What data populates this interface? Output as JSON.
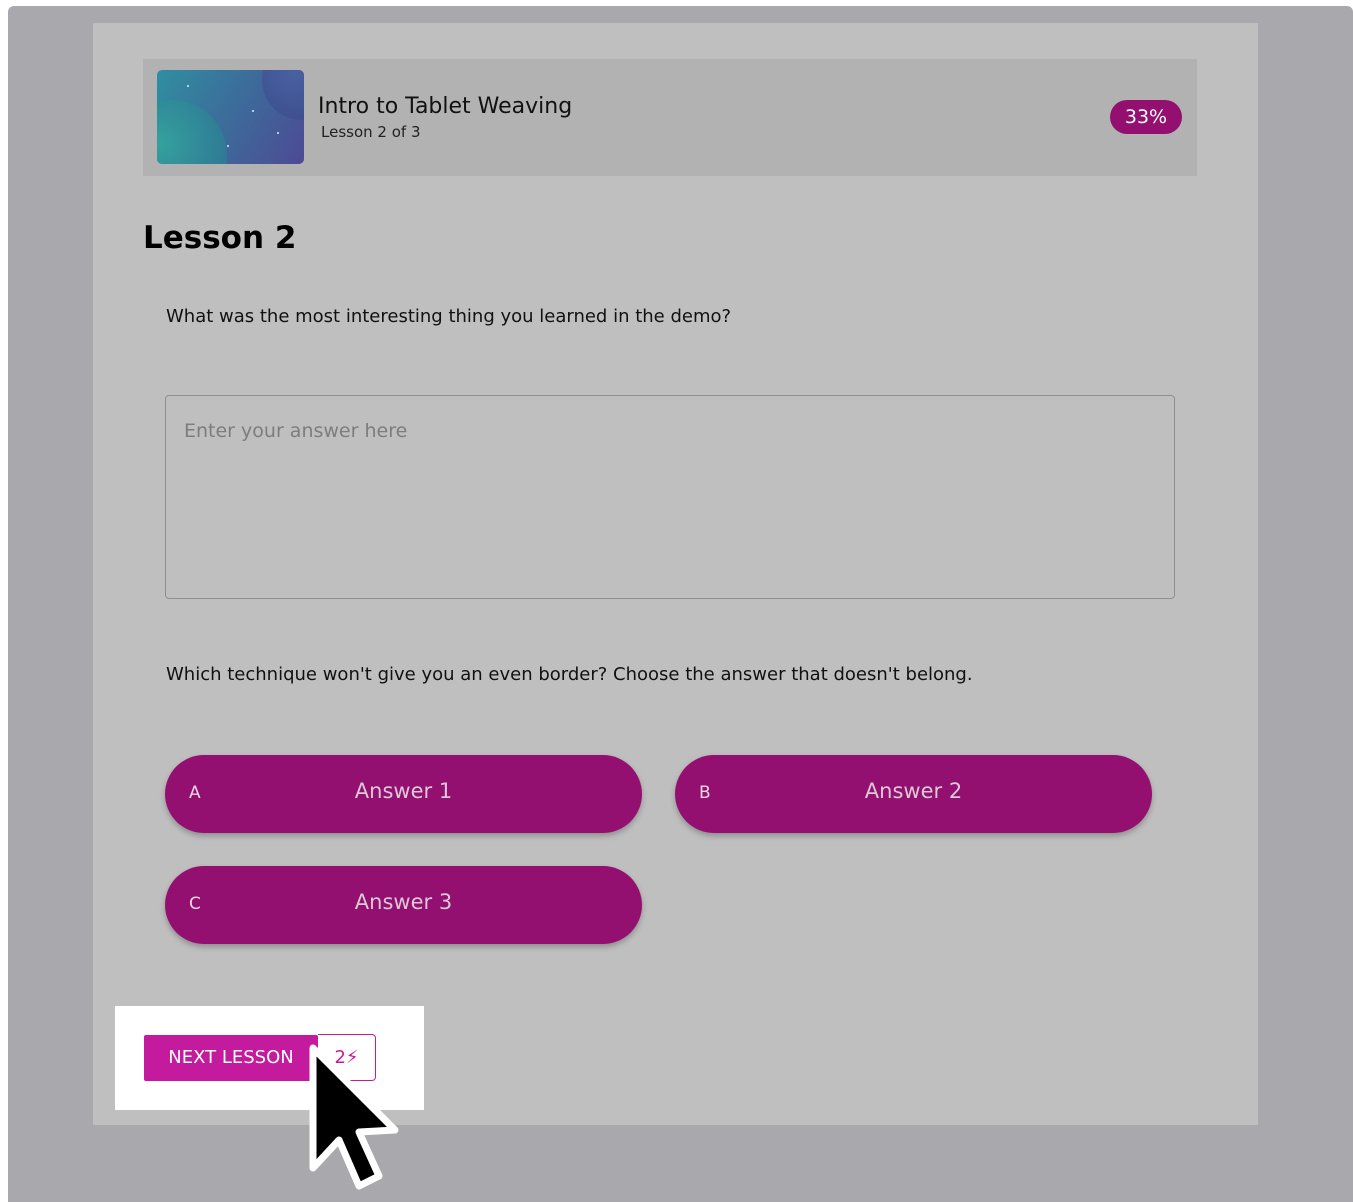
{
  "course": {
    "title": "Intro to Tablet Weaving",
    "subtitle": "Lesson 2 of 3",
    "progress_label": "33%",
    "thumbnail_icon": "space-planets-image"
  },
  "lesson": {
    "title": "Lesson 2",
    "question1": {
      "text": "What was the most interesting thing you learned in the demo?",
      "placeholder": "Enter your answer here"
    },
    "question2": {
      "text": "Which technique won't give you an even border? Choose the answer that doesn't belong.",
      "choices": [
        {
          "letter": "A",
          "label": "Answer 1"
        },
        {
          "letter": "B",
          "label": "Answer 2"
        },
        {
          "letter": "C",
          "label": "Answer 3"
        }
      ]
    }
  },
  "footer": {
    "next_label": "NEXT LESSON",
    "points_label": "2⚡"
  },
  "colors": {
    "accent": "#931070",
    "button": "#c41a9e",
    "panel": "#bfbfbf",
    "backdrop": "#a9a8ac"
  }
}
